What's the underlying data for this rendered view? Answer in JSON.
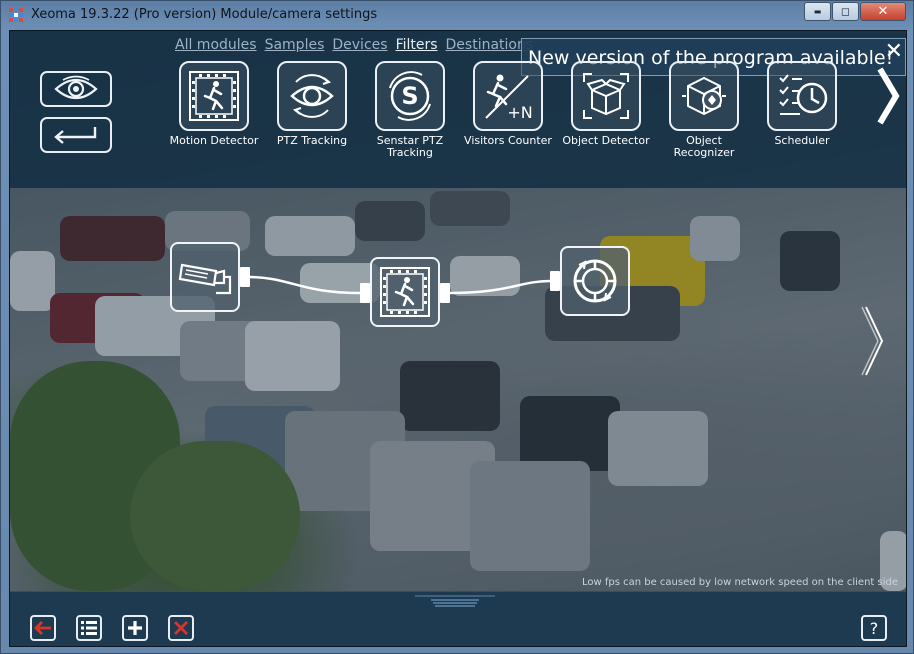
{
  "window": {
    "title": "Xeoma 19.3.22 (Pro version) Module/camera settings",
    "buttons": {
      "minimize": "▬",
      "maximize": "◻",
      "close": "✕"
    }
  },
  "tabs": [
    {
      "label": "All modules",
      "active": false
    },
    {
      "label": "Samples",
      "active": false
    },
    {
      "label": "Devices",
      "active": false
    },
    {
      "label": "Filters",
      "active": true
    },
    {
      "label": "Destinations",
      "active": false
    }
  ],
  "notification": {
    "text": "New version of the program available!",
    "close": "✕"
  },
  "side_buttons": {
    "view": "eye-icon",
    "back": "return-arrow-icon"
  },
  "modules": [
    {
      "label": "Motion Detector",
      "icon": "motion-detector-icon"
    },
    {
      "label": "PTZ Tracking",
      "icon": "ptz-tracking-icon"
    },
    {
      "label": "Senstar PTZ Tracking",
      "icon": "senstar-icon"
    },
    {
      "label": "Visitors Counter",
      "icon": "visitors-counter-icon"
    },
    {
      "label": "Object Detector",
      "icon": "object-detector-icon"
    },
    {
      "label": "Object Recognizer",
      "icon": "object-recognizer-icon"
    },
    {
      "label": "Scheduler",
      "icon": "scheduler-icon"
    }
  ],
  "chain": [
    {
      "name": "camera",
      "icon": "camera-icon"
    },
    {
      "name": "motion-detector",
      "icon": "motion-detector-icon"
    },
    {
      "name": "preview-archive",
      "icon": "preview-archive-icon"
    }
  ],
  "status_text": "Low fps can be caused by low network speed on the client side",
  "bottom_buttons": [
    "back-icon",
    "list-icon",
    "plus-icon",
    "delete-icon",
    "help-icon"
  ],
  "colors": {
    "accent_red": "#d8342a",
    "tile_border": "#eaf0f5",
    "bg_panel": "#1e3a50"
  }
}
